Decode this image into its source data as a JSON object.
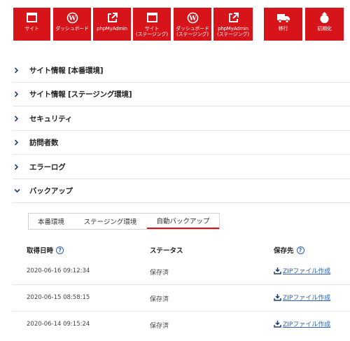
{
  "toolbar": {
    "buttons": [
      {
        "label": "サイト",
        "icon": "window-icon"
      },
      {
        "label": "ダッシュボード",
        "icon": "wordpress-icon"
      },
      {
        "label": "phpMyAdmin",
        "icon": "external-link-icon"
      },
      {
        "label": "サイト\n(ステージング)",
        "icon": "window-icon"
      },
      {
        "label": "ダッシュボード\n(ステージング)",
        "icon": "wordpress-icon"
      },
      {
        "label": "phpMyAdmin\n(ステージング)",
        "icon": "external-link-icon"
      },
      {
        "label": "移行",
        "icon": "moving-truck-icon"
      },
      {
        "label": "初期化",
        "icon": "reset-icon"
      }
    ],
    "accent_color": "#d7141a"
  },
  "sections": [
    {
      "title": "サイト情報 [本番環境]",
      "expanded": false
    },
    {
      "title": "サイト情報 [ステージング環境]",
      "expanded": false
    },
    {
      "title": "セキュリティ",
      "expanded": false
    },
    {
      "title": "訪問者数",
      "expanded": false
    },
    {
      "title": "エラーログ",
      "expanded": false
    },
    {
      "title": "バックアップ",
      "expanded": true
    }
  ],
  "backup": {
    "tabs": [
      {
        "label": "本番環境",
        "active": false
      },
      {
        "label": "ステージング環境",
        "active": false
      },
      {
        "label": "自動バックアップ",
        "active": true
      }
    ],
    "columns": [
      "取得日時",
      "ステータス",
      "保存先"
    ],
    "rows": [
      {
        "datetime": "2020-06-16 09:12:34",
        "status": "保存済",
        "destination": "ZIPファイル作成"
      },
      {
        "datetime": "2020-06-15 08:58:15",
        "status": "保存済",
        "destination": "ZIPファイル作成"
      },
      {
        "datetime": "2020-06-14 09:15:24",
        "status": "保存済",
        "destination": "ZIPファイル作成"
      }
    ]
  },
  "link_color": "#2b5fb0"
}
